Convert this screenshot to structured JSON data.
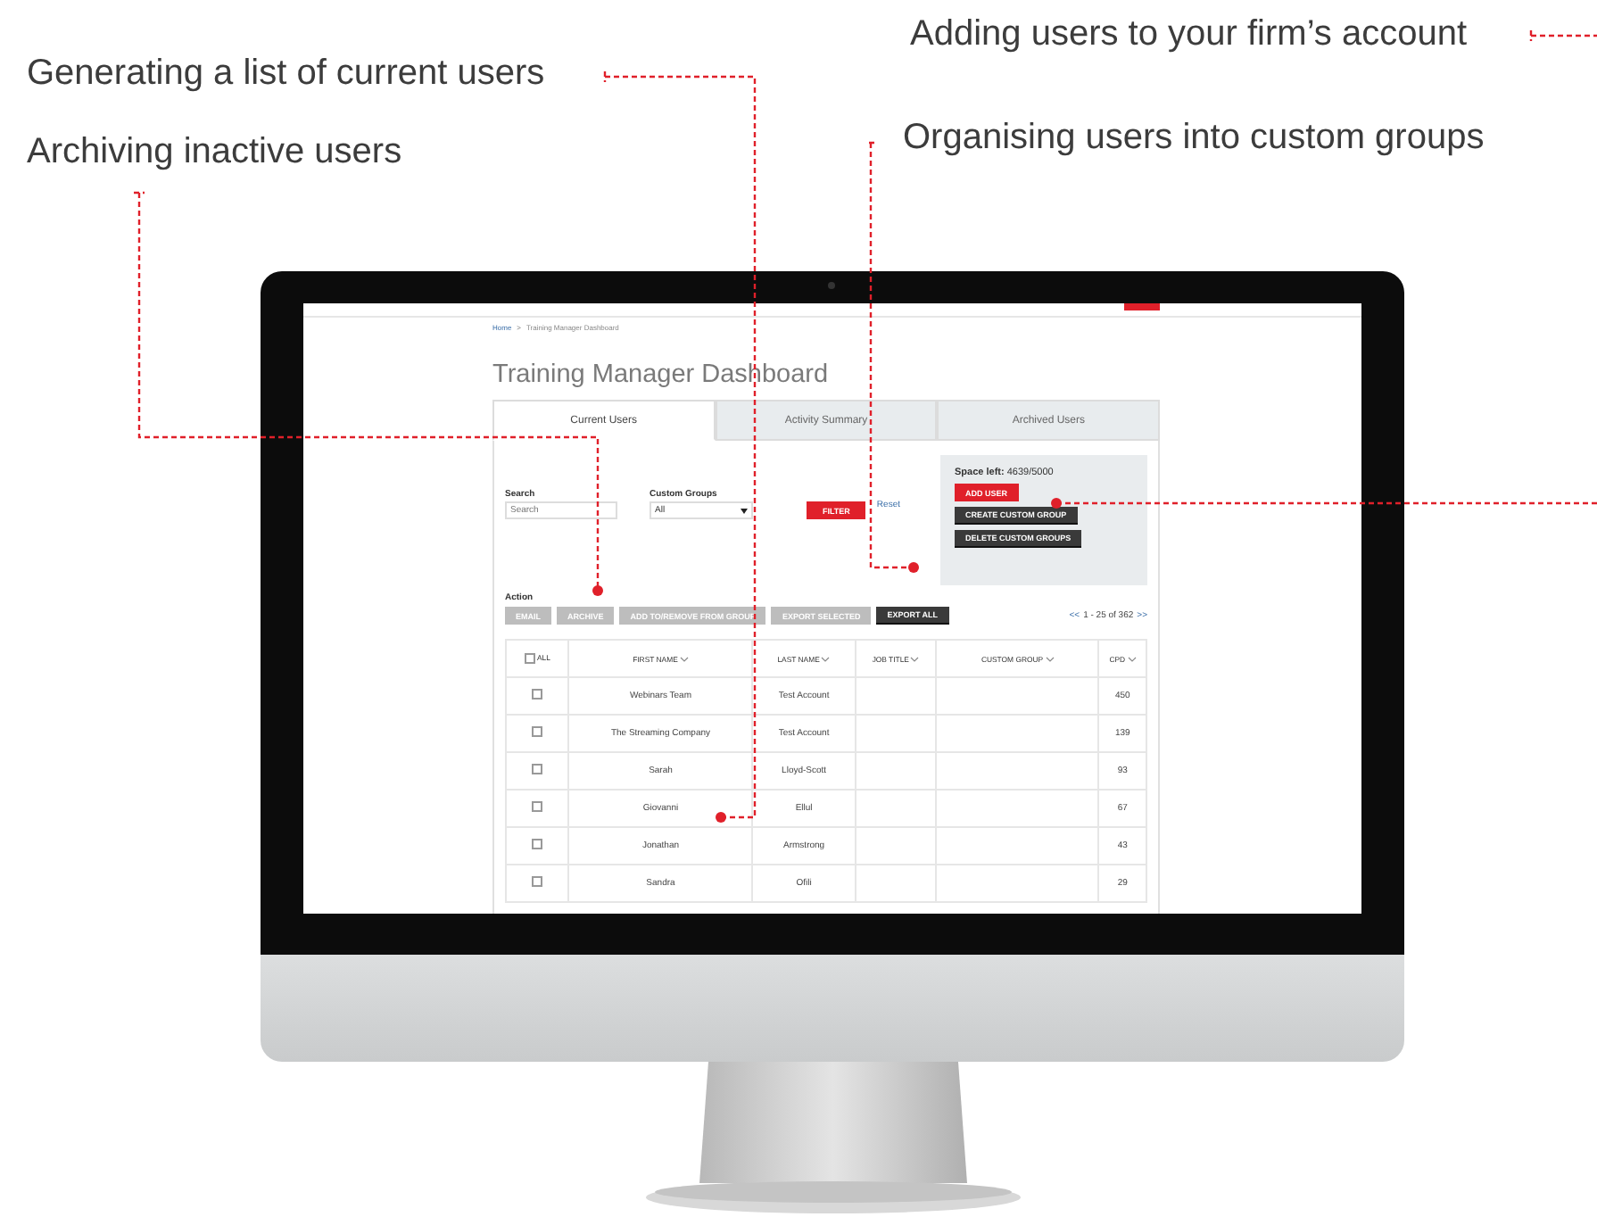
{
  "callouts": [
    {
      "text": "Generating a list of current users"
    },
    {
      "text": "Archiving inactive users"
    },
    {
      "text": "Adding users to your firm’s account"
    },
    {
      "text": "Organising users into custom groups"
    }
  ],
  "breadcrumb": {
    "home": "Home",
    "separator": ">",
    "current": "Training Manager Dashboard"
  },
  "title": "Training Manager Dashboard",
  "tabs": [
    {
      "label": "Current Users",
      "selected": true
    },
    {
      "label": "Activity Summary",
      "selected": false
    },
    {
      "label": "Archived Users",
      "selected": false
    }
  ],
  "filters": {
    "search_label": "Search",
    "search_placeholder": "Search",
    "group_label": "Custom Groups",
    "group_value": "All",
    "filter_button": "FILTER",
    "reset_link": "Reset"
  },
  "manage": {
    "space_left": "**Space left:** 4639/5000",
    "add_user": "ADD USER",
    "create_group": "CREATE CUSTOM GROUP",
    "delete_groups": "DELETE CUSTOM GROUPS"
  },
  "action_label": "Action",
  "actions": [
    {
      "label": "EMAIL",
      "disabled": true
    },
    {
      "label": "ARCHIVE",
      "disabled": true
    },
    {
      "label": "ADD TO/REMOVE FROM GROUP",
      "disabled": true
    },
    {
      "label": "EXPORT SELECTED",
      "disabled": true
    },
    {
      "label": "EXPORT ALL",
      "disabled": false
    }
  ],
  "pagination": {
    "prev": "<<",
    "range": "1 - 25 of 362",
    "next": ">>"
  },
  "table": {
    "select_all": {
      "label": "ALL",
      "checked": false
    },
    "columns": [
      "FIRST NAME",
      "LAST NAME",
      "JOB TITLE",
      "CUSTOM GROUP",
      "CPD"
    ],
    "rows": [
      {
        "checked": false,
        "first_name": "Webinars Team",
        "last_name": "Test Account",
        "cpd": "450"
      },
      {
        "checked": false,
        "first_name": "The Streaming Company",
        "last_name": "Test Account",
        "cpd": "139"
      },
      {
        "checked": false,
        "first_name": "Sarah",
        "last_name": "Lloyd-Scott",
        "cpd": "93"
      },
      {
        "checked": false,
        "first_name": "Giovanni",
        "last_name": "Ellul",
        "cpd": "67"
      },
      {
        "checked": false,
        "first_name": "Jonathan",
        "last_name": "Armstrong",
        "cpd": "43"
      },
      {
        "checked": false,
        "first_name": "Sandra",
        "last_name": "Ofili",
        "cpd": "29"
      }
    ]
  }
}
